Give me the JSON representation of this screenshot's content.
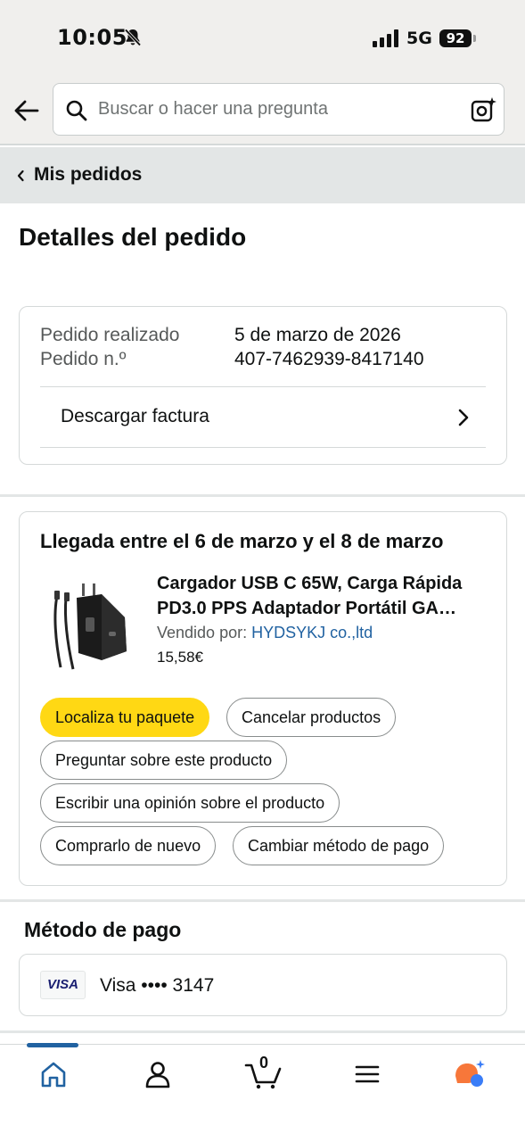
{
  "status_bar": {
    "time": "10:05",
    "network": "5G",
    "battery": "92"
  },
  "search": {
    "placeholder": "Buscar o hacer una pregunta"
  },
  "breadcrumb": {
    "label": "Mis pedidos"
  },
  "page": {
    "title": "Detalles del pedido"
  },
  "order_info": {
    "rows": [
      {
        "label": "Pedido realizado",
        "value": "5 de marzo de 2026"
      },
      {
        "label": "Pedido n.º",
        "value": "407-7462939-8417140"
      }
    ],
    "invoice_label": "Descargar factura"
  },
  "shipment": {
    "title": "Llegada entre el 6 de marzo y el 8 de marzo",
    "product_name_line1": "Cargador USB C 65W, Carga Rápida",
    "product_name_line2": "PD3.0 PPS Adaptador Portátil GA…",
    "seller_prefix": "Vendido por: ",
    "seller_name": "HYDSYKJ co.,ltd",
    "price": "15,58€",
    "actions": {
      "track": "Localiza tu paquete",
      "cancel": "Cancelar productos",
      "ask": "Preguntar sobre este producto",
      "review": "Escribir una opinión sobre el producto",
      "buy_again": "Comprarlo de nuevo",
      "change_payment": "Cambiar método de pago"
    }
  },
  "payment": {
    "title": "Método de pago",
    "card_brand": "VISA",
    "card_text": "Visa •••• 3147"
  },
  "bottom_nav": {
    "cart_count": "0",
    "items": [
      "home-icon",
      "account-icon",
      "cart-icon",
      "menu-icon",
      "rufus-icon"
    ],
    "active_color": "#2162a1"
  },
  "colors": {
    "primary_button": "#ffd814",
    "link": "#2162a1",
    "assistant_orange": "#f7773a",
    "assistant_blue": "#3a7df7"
  }
}
